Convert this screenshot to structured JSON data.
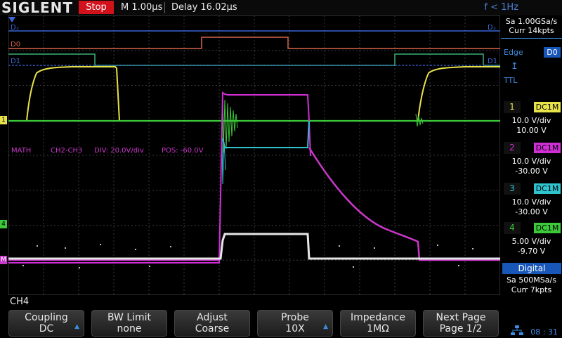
{
  "brand": {
    "logo": "SIGLENT"
  },
  "top": {
    "run_state": "Stop",
    "timebase": "M 1.00µs",
    "delay": "Delay 16.02µs",
    "freq": "f < 1Hz"
  },
  "acq": {
    "rate": "Sa 1.00GSa/s",
    "depth": "Curr 14kpts"
  },
  "trigger": {
    "mode": "Edge",
    "source": "D0",
    "slope_icon": "rising-edge-icon",
    "level_type": "TTL"
  },
  "channels": [
    {
      "num": "1",
      "tag": "DC1M",
      "vdiv": "10.0 V/div",
      "offset": "10.00 V",
      "color": "#e8e24a"
    },
    {
      "num": "2",
      "tag": "DC1M",
      "vdiv": "10.0 V/div",
      "offset": "-30.00 V",
      "color": "#d02fd7"
    },
    {
      "num": "3",
      "tag": "DC1M",
      "vdiv": "10.0 V/div",
      "offset": "-30.00 V",
      "color": "#2fc3cf"
    },
    {
      "num": "4",
      "tag": "DC1M",
      "vdiv": "5.00 V/div",
      "offset": "-9.70 V",
      "color": "#3cc93a"
    }
  ],
  "digital": {
    "label": "Digital",
    "rate": "Sa 500MSa/s",
    "depth": "Curr 7kpts"
  },
  "traces": {
    "dx_label": "Dₓ",
    "dx_label_right": "Dₓ",
    "d0_label": "D0",
    "d1_label": "D1",
    "d1_label_right": "D1",
    "ch1_marker": "1",
    "ch4_marker": "4",
    "math_marker": "M",
    "math_info": {
      "name": "MATH",
      "expr": "CH2-CH3",
      "div": "DIV: 20.0V/div",
      "pos": "POS: -60.0V"
    }
  },
  "bottom": {
    "channel": "CH4",
    "buttons": [
      {
        "label": "Coupling",
        "value": "DC",
        "arrow": true
      },
      {
        "label": "BW Limit",
        "value": "none",
        "arrow": false
      },
      {
        "label": "Adjust",
        "value": "Coarse",
        "arrow": false
      },
      {
        "label": "Probe",
        "value": "10X",
        "arrow": true
      },
      {
        "label": "Impedance",
        "value": "1MΩ",
        "arrow": false
      },
      {
        "label": "Next Page",
        "value": "Page 1/2",
        "arrow": false
      }
    ],
    "time": "08 : 31"
  },
  "colors": {
    "d_blue": "#3a66d6",
    "d0": "#d8644a",
    "d1": "#3ab07a",
    "math": "#c838c8",
    "ch4_white": "#e6e6e6"
  }
}
